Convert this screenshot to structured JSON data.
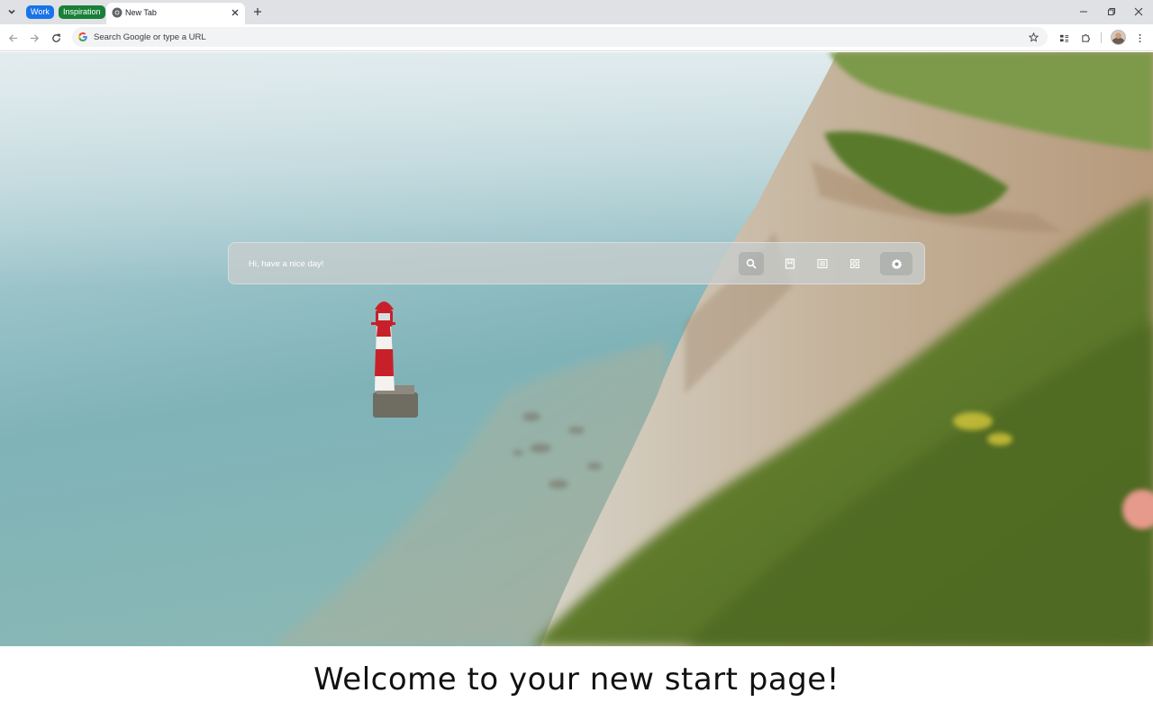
{
  "browser": {
    "tab_groups": [
      {
        "label": "Work",
        "color": "#1a73e8"
      },
      {
        "label": "Inspiration",
        "color": "#188038"
      }
    ],
    "active_tab": {
      "title": "New Tab",
      "icon": "chrome-icon"
    },
    "omnibox": {
      "placeholder": "Search Google or type a URL",
      "value": ""
    },
    "toolbar_icons": [
      "back-icon",
      "forward-icon",
      "reload-icon",
      "bookmark-star-icon",
      "reading-list-icon",
      "extensions-icon",
      "profile-avatar",
      "menu-icon"
    ]
  },
  "start_page": {
    "search": {
      "placeholder": "Hi, have a nice day!",
      "value": ""
    },
    "buttons": [
      "search-icon",
      "bookmarks-icon",
      "notes-icon",
      "apps-grid-icon",
      "settings-icon"
    ],
    "background": "lighthouse-cliffs-photo"
  },
  "caption": "Welcome to your new start page!"
}
